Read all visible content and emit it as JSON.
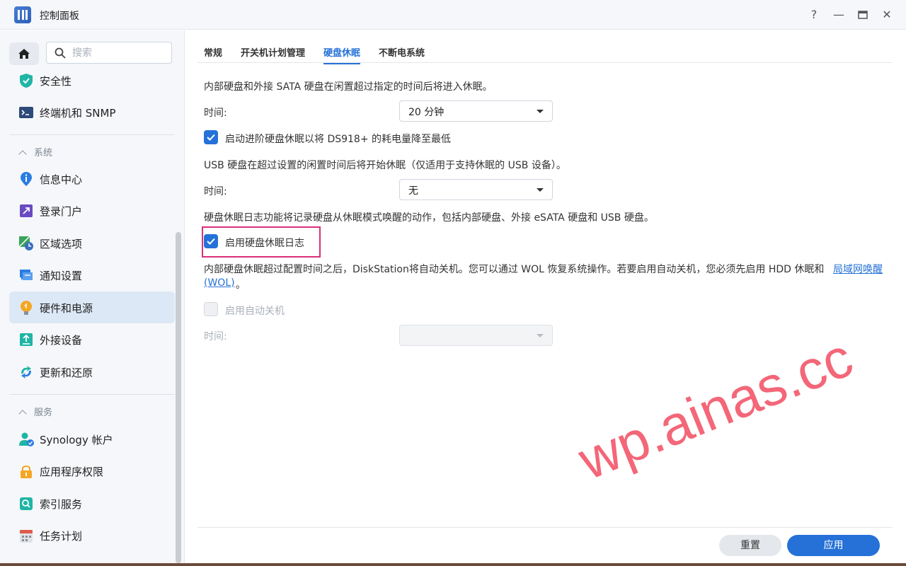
{
  "window": {
    "title": "控制面板",
    "help_label": "?",
    "minimize_label": "—",
    "close_label": "✕"
  },
  "sidebar": {
    "search_placeholder": "搜索",
    "items_top": [
      {
        "label": "安全性",
        "icon": "shield-icon"
      },
      {
        "label": "终端机和 SNMP",
        "icon": "terminal-icon"
      }
    ],
    "sections": [
      {
        "header": "系统",
        "items": [
          {
            "label": "信息中心",
            "icon": "info-icon"
          },
          {
            "label": "登录门户",
            "icon": "login-portal-icon"
          },
          {
            "label": "区域选项",
            "icon": "region-icon"
          },
          {
            "label": "通知设置",
            "icon": "notification-icon"
          },
          {
            "label": "硬件和电源",
            "icon": "bulb-icon",
            "active": true
          },
          {
            "label": "外接设备",
            "icon": "external-device-icon"
          },
          {
            "label": "更新和还原",
            "icon": "update-icon"
          }
        ]
      },
      {
        "header": "服务",
        "items": [
          {
            "label": "Synology 帐户",
            "icon": "account-icon"
          },
          {
            "label": "应用程序权限",
            "icon": "lock-icon"
          },
          {
            "label": "索引服务",
            "icon": "index-icon"
          },
          {
            "label": "任务计划",
            "icon": "calendar-icon"
          }
        ]
      }
    ]
  },
  "tabs": [
    {
      "label": "常规",
      "active": false
    },
    {
      "label": "开关机计划管理",
      "active": false
    },
    {
      "label": "硬盘休眠",
      "active": true
    },
    {
      "label": "不断电系统",
      "active": false
    }
  ],
  "content": {
    "internal_desc": "内部硬盘和外接 SATA 硬盘在闲置超过指定的时间后将进入休眠。",
    "time_label": "时间:",
    "internal_time_value": "20 分钟",
    "advanced_hibernation_label": "启动进阶硬盘休眠以将 DS918+ 的耗电量降至最低",
    "advanced_hibernation_checked": true,
    "usb_desc": "USB 硬盘在超过设置的闲置时间后将开始休眠（仅适用于支持休眠的 USB 设备）。",
    "usb_time_value": "无",
    "log_desc": "硬盘休眠日志功能将记录硬盘从休眠模式唤醒的动作，包括内部硬盘、外接 eSATA 硬盘和 USB 硬盘。",
    "enable_log_label": "启用硬盘休眠日志",
    "enable_log_checked": true,
    "auto_shutdown_desc_line1": "内部硬盘休眠超过配置时间之后，DiskStation将自动关机。您可以通过 WOL 恢复系统操作。若要启用自动关机，您必须先启用 HDD 休眠和",
    "wol_link_part1": "局域网唤醒",
    "wol_link_part2": "(WOL)",
    "auto_shutdown_desc_end": "。",
    "enable_auto_shutdown_label": "启用自动关机",
    "enable_auto_shutdown_checked": false,
    "auto_shutdown_time_value": ""
  },
  "footer": {
    "reset_label": "重置",
    "apply_label": "应用"
  },
  "watermark": "wp.ainas.cc",
  "colors": {
    "accent": "#2571d7",
    "highlight_border": "#d8307a",
    "sidebar_bg": "#f5f7fa",
    "active_item_bg": "#dde8f6"
  }
}
